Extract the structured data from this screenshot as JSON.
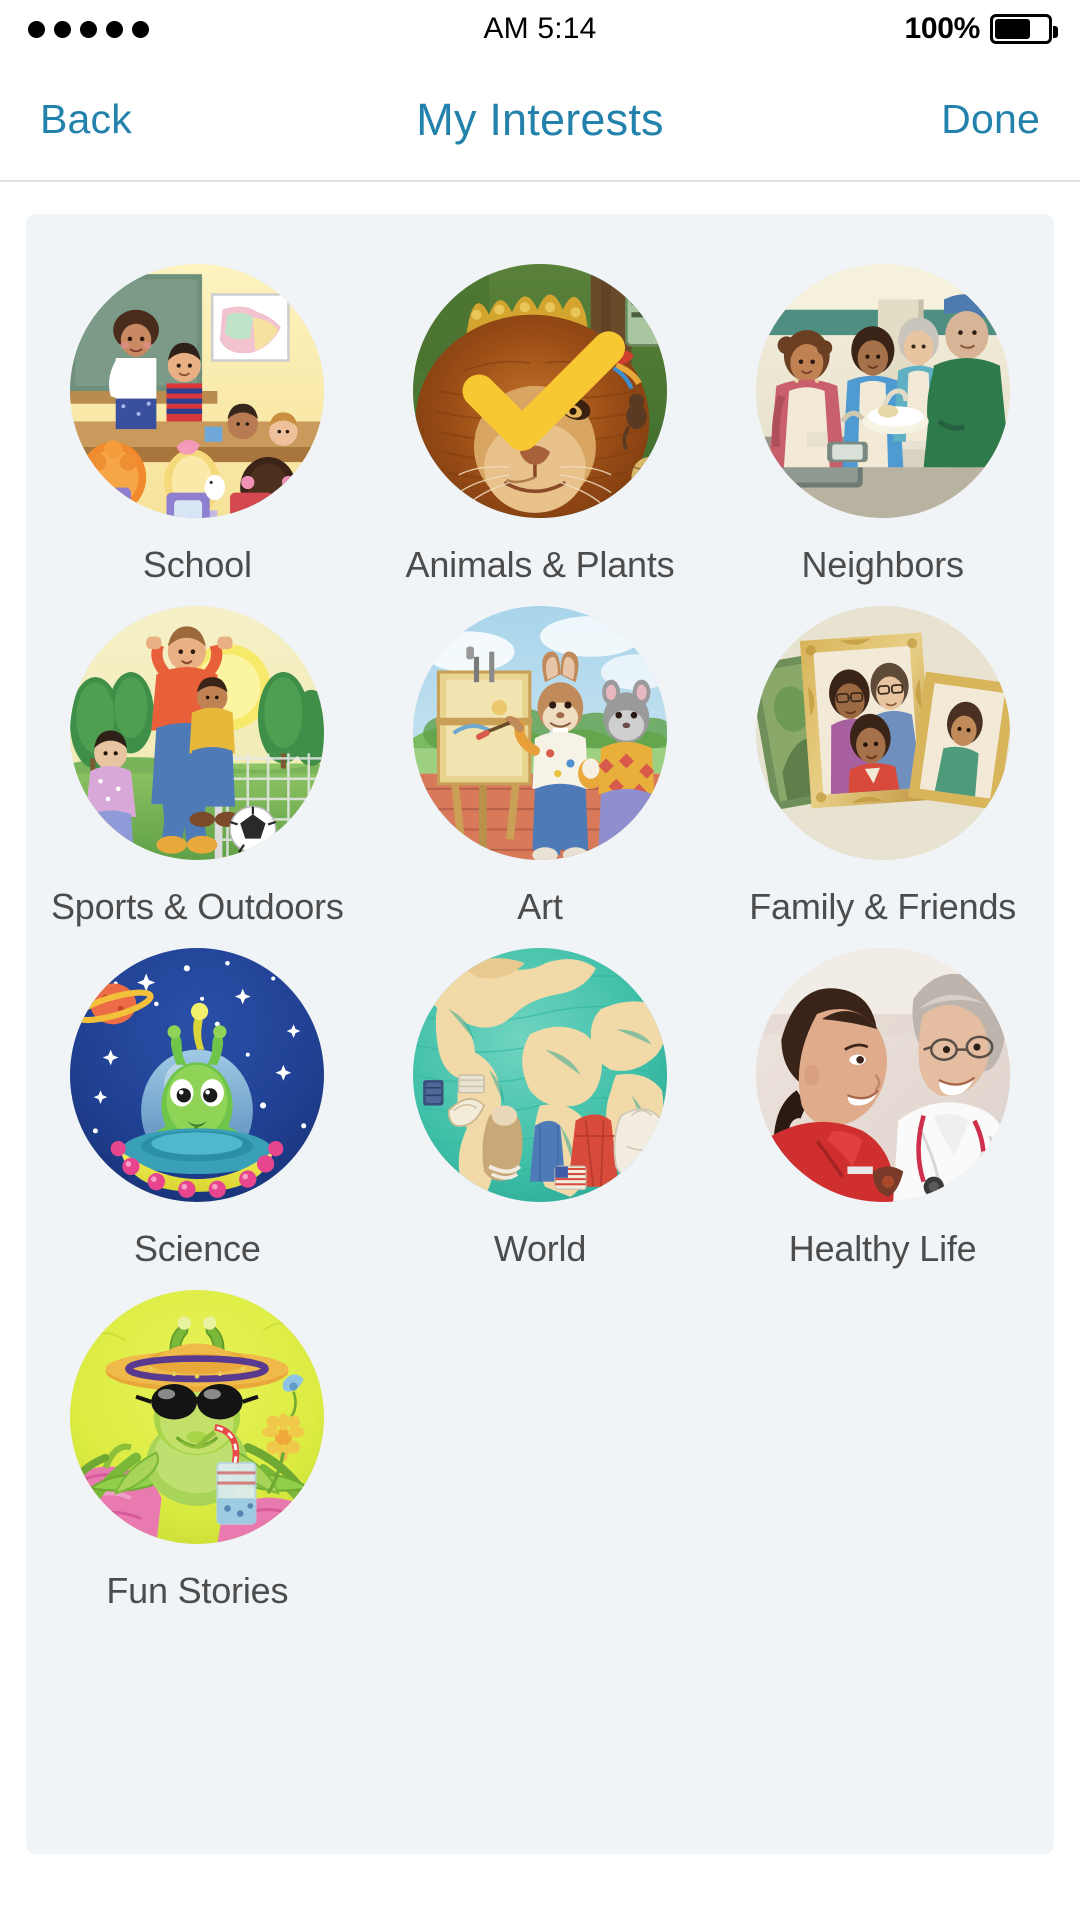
{
  "status_bar": {
    "signal_dots": 5,
    "time": "AM 5:14",
    "battery_percent": "100%",
    "battery_icon": "battery-icon"
  },
  "nav": {
    "back_label": "Back",
    "title": "My Interests",
    "done_label": "Done",
    "accent_color": "#2382ab"
  },
  "theme": {
    "panel_background": "#f0f4f7",
    "page_background": "#ffffff",
    "label_color": "#4c4c4c",
    "check_color": "#f8c832"
  },
  "interests": [
    {
      "id": "school",
      "label": "School",
      "selected": false,
      "image": "classroom-illustration"
    },
    {
      "id": "animals-plants",
      "label": "Animals & Plants",
      "selected": true,
      "image": "lion-illustration"
    },
    {
      "id": "neighbors",
      "label": "Neighbors",
      "selected": false,
      "image": "soup-kitchen-illustration"
    },
    {
      "id": "sports-outdoors",
      "label": "Sports & Outdoors",
      "selected": false,
      "image": "soccer-illustration"
    },
    {
      "id": "art",
      "label": "Art",
      "selected": false,
      "image": "rabbit-painting-illustration"
    },
    {
      "id": "family-friends",
      "label": "Family & Friends",
      "selected": false,
      "image": "family-photos-illustration"
    },
    {
      "id": "science",
      "label": "Science",
      "selected": false,
      "image": "alien-ufo-illustration"
    },
    {
      "id": "world",
      "label": "World",
      "selected": false,
      "image": "globe-illustration"
    },
    {
      "id": "healthy-life",
      "label": "Healthy Life",
      "selected": false,
      "image": "doctor-child-photo"
    },
    {
      "id": "fun-stories",
      "label": "Fun Stories",
      "selected": false,
      "image": "grasshopper-illustration"
    }
  ]
}
